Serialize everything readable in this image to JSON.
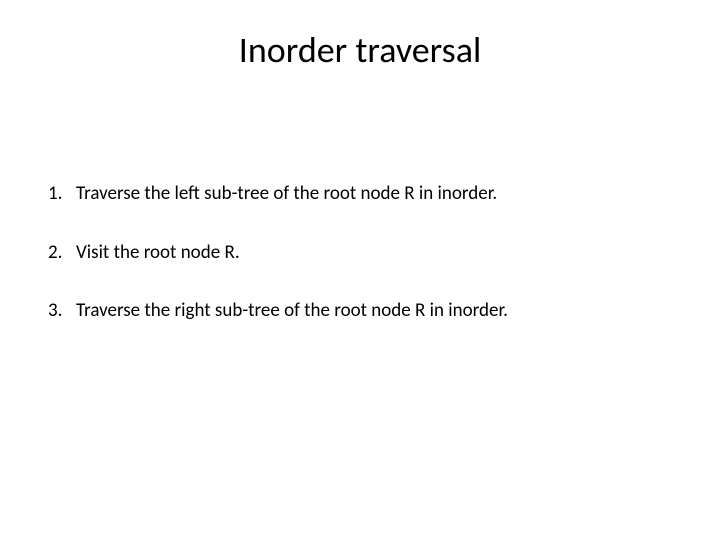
{
  "title": "Inorder  traversal",
  "items": [
    {
      "number": "1.",
      "text": "Traverse the left sub-tree of the root node R in inorder."
    },
    {
      "number": "2.",
      "text": "Visit the root node R."
    },
    {
      "number": "3.",
      "text": "Traverse the right sub-tree of the root node R in inorder."
    }
  ]
}
